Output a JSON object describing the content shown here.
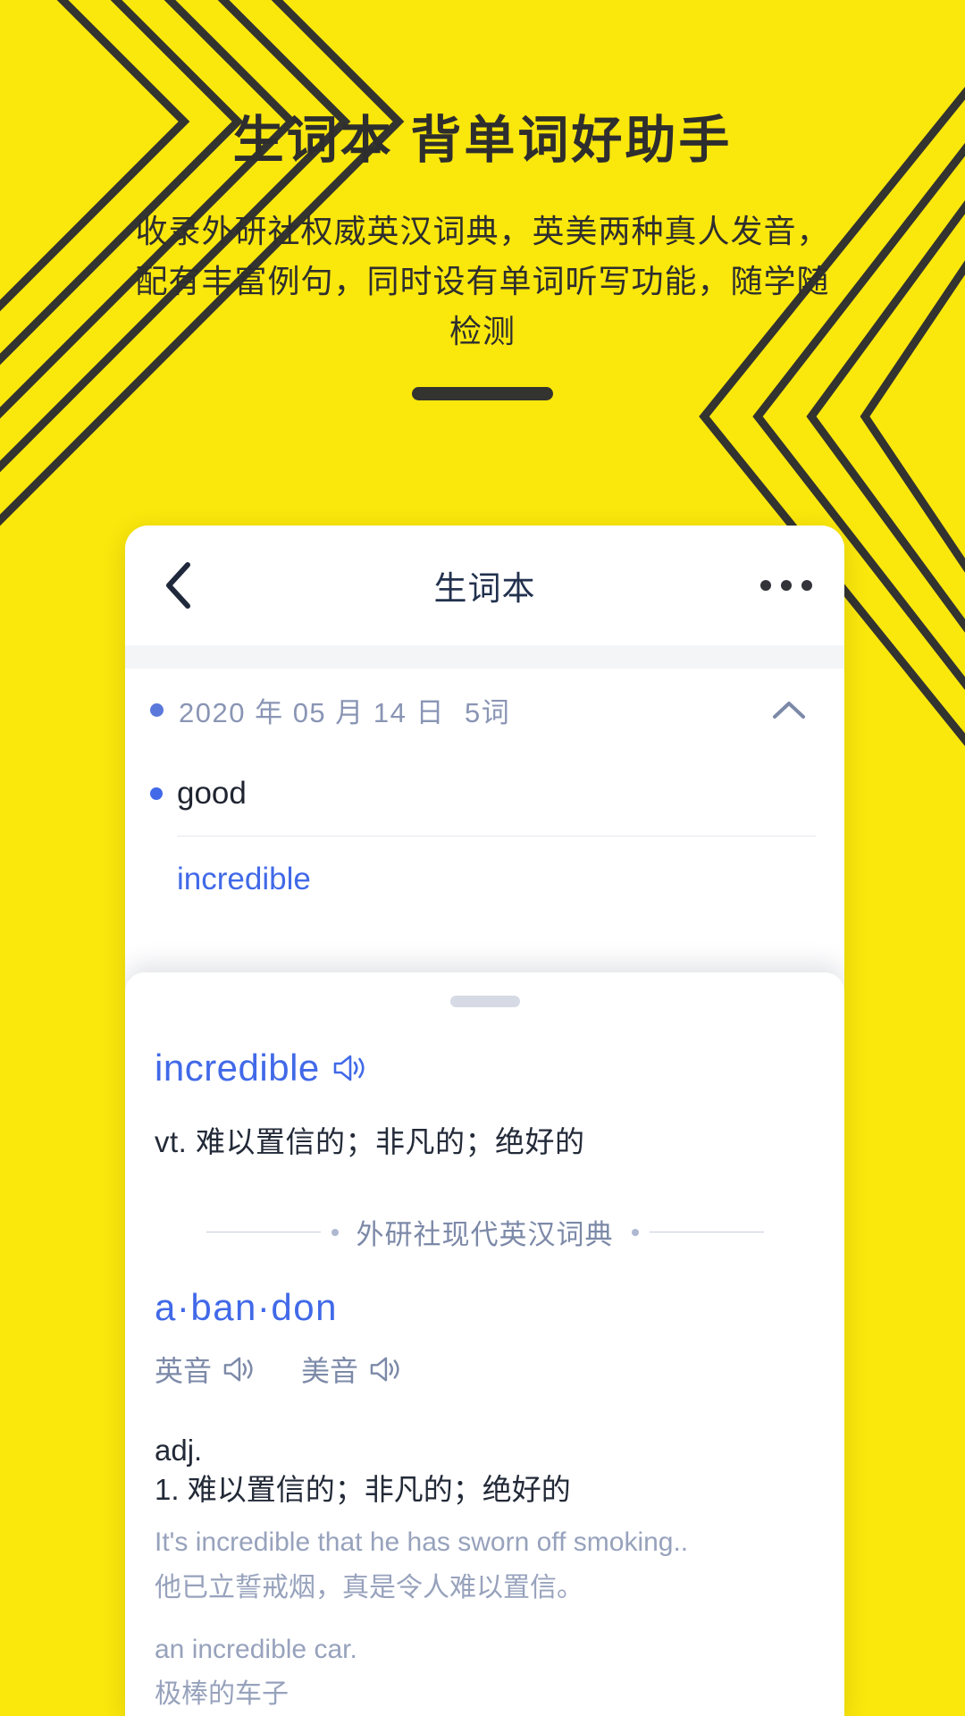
{
  "theme": {
    "background": "#FAE70C",
    "ink": "#2E2E2E",
    "accent_blue": "#4169E8",
    "muted_blue": "#8995B4",
    "sheet_white": "#FFFFFF"
  },
  "hero": {
    "title": "生词本  背单词好助手",
    "subtitle": "收录外研社权威英汉词典，英美两种真人发音，配有丰富例句，同时设有单词听写功能，随学随检测"
  },
  "phone": {
    "navbar": {
      "back_icon": "chevron-left-icon",
      "title": "生词本",
      "more_icon": "more-horizontal-icon"
    },
    "wordlist": {
      "group": {
        "date": "2020 年 05 月 14 日",
        "count": "5词",
        "caret_icon": "chevron-up-icon"
      },
      "words": [
        {
          "text": "good",
          "selected": false
        },
        {
          "text": "incredible",
          "selected": true
        }
      ]
    },
    "sheet": {
      "handle": "drag-handle",
      "entry": {
        "word": "incredible",
        "speaker_icon": "speaker-icon",
        "brief": "vt. 难以置信的；非凡的；绝好的"
      },
      "dictionary_name": "外研社现代英汉词典",
      "headword": "a·ban·don",
      "pronunciations": [
        {
          "label": "英音",
          "icon": "speaker-icon"
        },
        {
          "label": "美音",
          "icon": "speaker-icon"
        }
      ],
      "part_of_speech": "adj.",
      "senses": [
        {
          "number": "1.",
          "text": "难以置信的；非凡的；绝好的"
        }
      ],
      "examples": [
        {
          "en": "It's incredible that he has sworn off smoking..",
          "zh": "他已立誓戒烟，真是令人难以置信。"
        },
        {
          "en": "an incredible car.",
          "zh": "极棒的车子"
        }
      ]
    }
  }
}
